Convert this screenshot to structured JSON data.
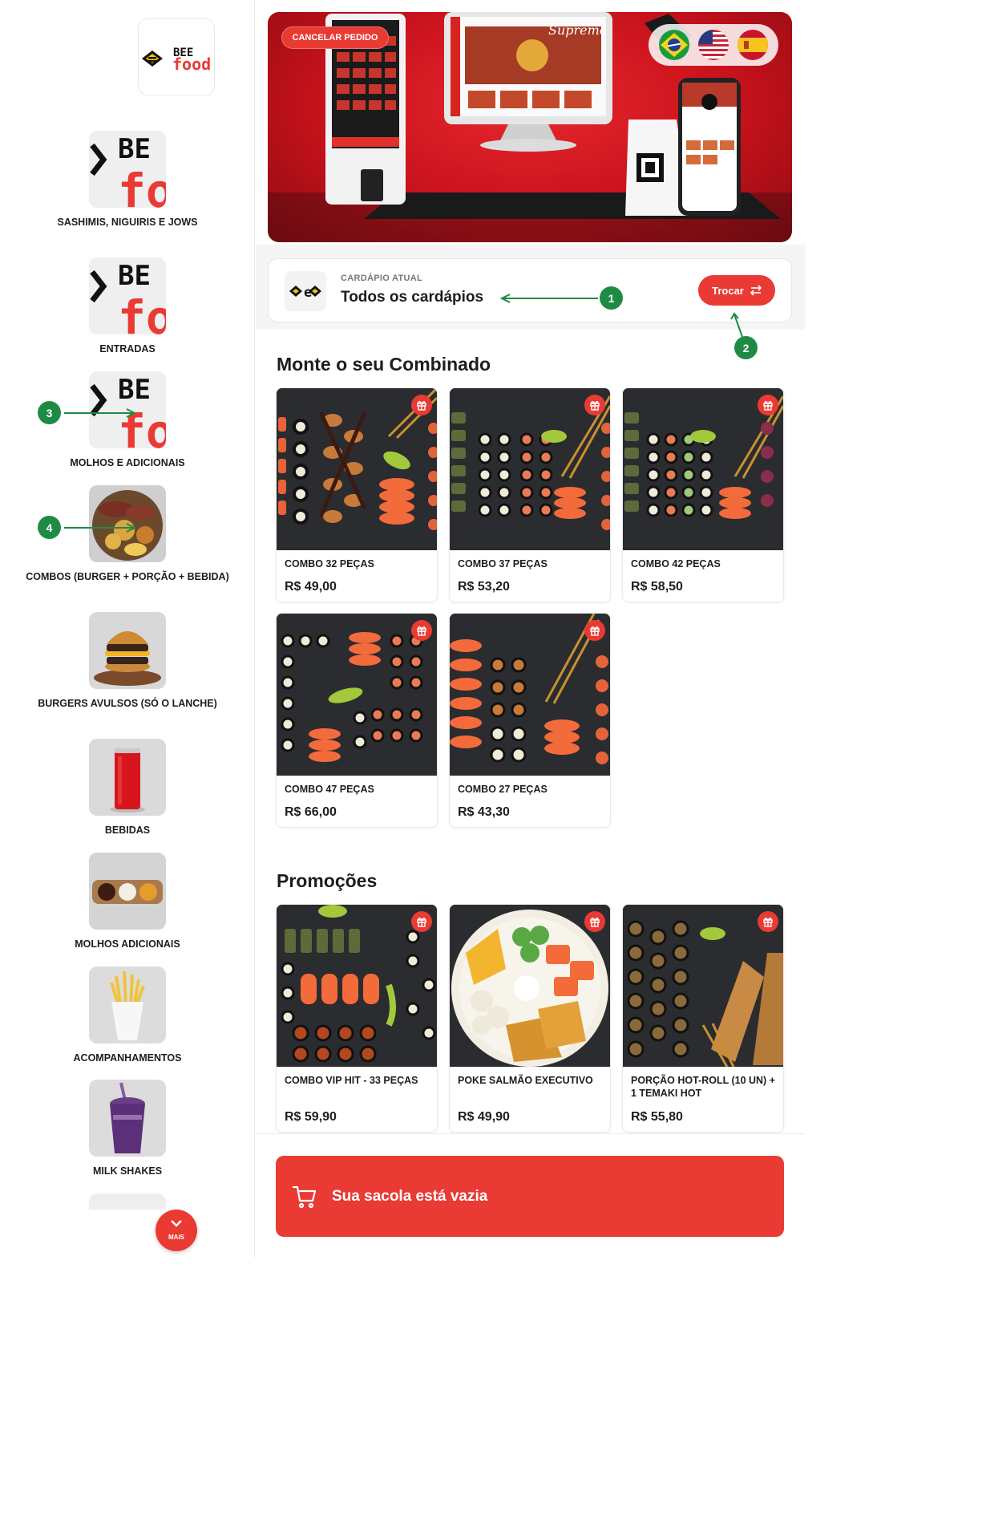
{
  "brand": {
    "name_top": "BEE",
    "name_bottom": "food",
    "accent": "#ea3a34",
    "annotation_color": "#1e8b45"
  },
  "banner": {
    "cancel_label": "CANCELAR PEDIDO",
    "kiosk_sign": "Supreme",
    "languages": [
      {
        "name": "Português",
        "icon": "brazil-flag-icon"
      },
      {
        "name": "English",
        "icon": "usa-flag-icon"
      },
      {
        "name": "Español",
        "icon": "spain-flag-icon"
      }
    ]
  },
  "sidebar": {
    "items": [
      {
        "label": "SASHIMIS, NIGUIRIS E JOWS",
        "image": "bee-food-placeholder"
      },
      {
        "label": "ENTRADAS",
        "image": "bee-food-placeholder"
      },
      {
        "label": "MOLHOS E ADICIONAIS",
        "image": "bee-food-placeholder"
      },
      {
        "label": "COMBOS (BURGER + PORÇÃO + BEBIDA)",
        "image": "meat-platter"
      },
      {
        "label": "BURGERS AVULSOS (SÓ O LANCHE)",
        "image": "burger"
      },
      {
        "label": "BEBIDAS",
        "image": "soda-can"
      },
      {
        "label": "MOLHOS ADICIONAIS",
        "image": "sauces"
      },
      {
        "label": "ACOMPANHAMENTOS",
        "image": "fries"
      },
      {
        "label": "MILK SHAKES",
        "image": "milkshake"
      }
    ],
    "more_label": "MAIS"
  },
  "menu_selector": {
    "label": "CARDÁPIO ATUAL",
    "current": "Todos os cardápios",
    "swap_label": "Trocar"
  },
  "annotations": [
    "1",
    "2",
    "3",
    "4"
  ],
  "sections": [
    {
      "title": "Monte o seu Combinado",
      "products": [
        {
          "name": "COMBO 32 PEÇAS",
          "price": "R$ 49,00"
        },
        {
          "name": "COMBO 37 PEÇAS",
          "price": "R$ 53,20"
        },
        {
          "name": "COMBO 42 PEÇAS",
          "price": "R$ 58,50"
        },
        {
          "name": "COMBO 47 PEÇAS",
          "price": "R$ 66,00"
        },
        {
          "name": "COMBO 27 PEÇAS",
          "price": "R$ 43,30"
        }
      ]
    },
    {
      "title": "Promoções",
      "products": [
        {
          "name": "COMBO VIP HIT - 33 PEÇAS",
          "price": "R$ 59,90"
        },
        {
          "name": "POKE SALMÃO EXECUTIVO",
          "price": "R$ 49,90"
        },
        {
          "name": "PORÇÃO HOT-ROLL (10 UN) + 1 TEMAKI HOT",
          "price": "R$ 55,80"
        }
      ]
    }
  ],
  "bag": {
    "label": "Sua sacola está vazia"
  }
}
